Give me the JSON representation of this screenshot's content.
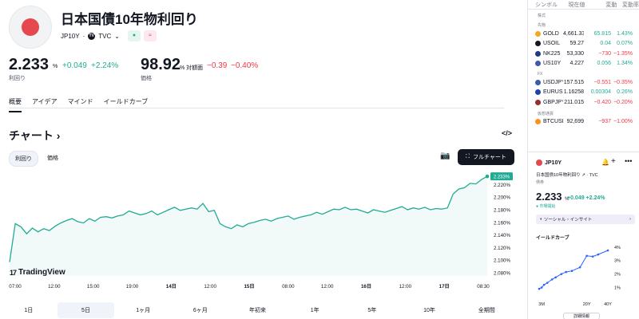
{
  "header": {
    "title": "日本国債10年物利回り",
    "symbol": "JP10Y",
    "exchange": "TVC",
    "badge_green": "●",
    "badge_pink": "≈"
  },
  "quote": {
    "yield_value": "2.233",
    "yield_unit": "%",
    "yield_change": "+0.049",
    "yield_change_pct": "+2.24%",
    "yield_label": "利回り",
    "price_value": "98.92",
    "price_unit": "% 対額面",
    "price_change": "−0.39",
    "price_change_pct": "−0.40%",
    "price_label": "価格"
  },
  "tabs": [
    "概要",
    "アイデア",
    "マインド",
    "イールドカーブ"
  ],
  "chart_section": {
    "title": "チャート",
    "title_arrow": "›",
    "embed_icon": "</>",
    "toggle": [
      "利回り",
      "価格"
    ],
    "fullchart_label": "フルチャート",
    "logo_text": "TradingView",
    "logo_mark": "17"
  },
  "ranges": [
    "1日",
    "5日",
    "1ヶ月",
    "6ヶ月",
    "年初来",
    "1年",
    "5年",
    "10年",
    "全期間"
  ],
  "chart_data": {
    "type": "line",
    "title": "",
    "x_ticks": [
      "07:00",
      "12:00",
      "15:00",
      "19:00",
      "14日",
      "12:00",
      "15日",
      "08:00",
      "12:00",
      "16日",
      "12:00",
      "17日",
      "08:30"
    ],
    "bold_ticks": [
      "14日",
      "15日",
      "16日",
      "17日"
    ],
    "y_ticks": [
      "2.220%",
      "2.200%",
      "2.180%",
      "2.160%",
      "2.140%",
      "2.120%",
      "2.100%",
      "2.080%"
    ],
    "ylim": [
      2.075,
      2.237
    ],
    "last_value_label": "2.233%",
    "series": [
      {
        "values": [
          2.097,
          2.158,
          2.153,
          2.142,
          2.151,
          2.145,
          2.15,
          2.147,
          2.154,
          2.159,
          2.163,
          2.166,
          2.161,
          2.159,
          2.166,
          2.162,
          2.168,
          2.169,
          2.167,
          2.17,
          2.172,
          2.178,
          2.175,
          2.172,
          2.174,
          2.178,
          2.172,
          2.176,
          2.18,
          2.184,
          2.179,
          2.181,
          2.183,
          2.181,
          2.19,
          2.177,
          2.179,
          2.158,
          2.153,
          2.15,
          2.156,
          2.153,
          2.158,
          2.16,
          2.163,
          2.165,
          2.162,
          2.166,
          2.168,
          2.17,
          2.165,
          2.168,
          2.17,
          2.172,
          2.176,
          2.173,
          2.177,
          2.181,
          2.18,
          2.184,
          2.18,
          2.181,
          2.178,
          2.175,
          2.18,
          2.178,
          2.176,
          2.179,
          2.182,
          2.185,
          2.18,
          2.183,
          2.181,
          2.184,
          2.18,
          2.182,
          2.181,
          2.183,
          2.205,
          2.213,
          2.215,
          2.222,
          2.221,
          2.228,
          2.233
        ]
      }
    ],
    "grid": false
  },
  "watchlist": {
    "headers": [
      "シンボル",
      "現在値",
      "変動",
      "変動率"
    ],
    "sections": [
      {
        "name": "株式",
        "rows": []
      },
      {
        "name": "先物",
        "rows": [
          {
            "name": "GOLD",
            "price": "4,661.330",
            "change": "65.815",
            "pct": "1.43%",
            "dir": "up",
            "icon_color": "#f5a623",
            "icon": "gold-icon"
          },
          {
            "name": "USOIL",
            "price": "59.27",
            "change": "0.04",
            "pct": "0.07%",
            "dir": "up",
            "icon_color": "#131722",
            "icon": "oil-drop-icon"
          },
          {
            "name": "NK225",
            "price": "53,330",
            "change": "−730",
            "pct": "−1.35%",
            "dir": "dn",
            "icon_color": "#1e3a8a",
            "icon": "nk225-icon"
          },
          {
            "name": "US10Y",
            "price": "4.227",
            "change": "0.056",
            "pct": "1.34%",
            "dir": "up",
            "icon_color": "#3c5ba9",
            "icon": "us-flag-icon"
          }
        ]
      },
      {
        "name": "FX",
        "rows": [
          {
            "name": "USDJPY",
            "price": "157.515",
            "change": "−0.551",
            "pct": "−0.35%",
            "dir": "dn",
            "icon_color": "#3c5ba9",
            "icon": "usdjpy-flag-icon"
          },
          {
            "name": "EURUSD",
            "price": "1.16258",
            "change": "0.00304",
            "pct": "0.26%",
            "dir": "up",
            "icon_color": "#1e40af",
            "icon": "eurusd-flag-icon"
          },
          {
            "name": "GBPJPY",
            "price": "211.015",
            "change": "−0.420",
            "pct": "−0.20%",
            "dir": "dn",
            "icon_color": "#9b2c2c",
            "icon": "gbpjpy-flag-icon"
          }
        ]
      },
      {
        "name": "仮想通貨",
        "rows": [
          {
            "name": "BTCUSD",
            "price": "92,699",
            "change": "−937",
            "pct": "−1.00%",
            "dir": "dn",
            "icon_color": "#f7931a",
            "icon": "bitcoin-icon"
          }
        ]
      }
    ]
  },
  "detail": {
    "symbol": "JP10Y",
    "name": "日本国債10年物利回り",
    "name_suffix": "· TVC",
    "subtitle": "債券",
    "price": "2.233",
    "price_unit": "%",
    "change": "+0.049",
    "change_pct": "+2.24%",
    "market_status": "● 市場開始",
    "social_label": "ソーシャル・インサイト",
    "yield_curve_title": "イールドカーブ",
    "detail_button": "詳細情報",
    "yield_curve": {
      "type": "line",
      "x_ticks": [
        "3M",
        "20Y",
        "40Y"
      ],
      "y_ticks": [
        "4%",
        "3%",
        "2%",
        "1%"
      ],
      "ylim": [
        0.5,
        4.4
      ],
      "points": [
        [
          0.08,
          0.9
        ],
        [
          0.25,
          1.0
        ],
        [
          0.5,
          1.2
        ],
        [
          1,
          1.35
        ],
        [
          2,
          1.6
        ],
        [
          3,
          1.75
        ],
        [
          5,
          2.0
        ],
        [
          7,
          2.15
        ],
        [
          10,
          2.23
        ],
        [
          15,
          2.5
        ],
        [
          20,
          3.35
        ],
        [
          25,
          3.3
        ],
        [
          30,
          3.45
        ],
        [
          40,
          3.75
        ]
      ]
    }
  }
}
